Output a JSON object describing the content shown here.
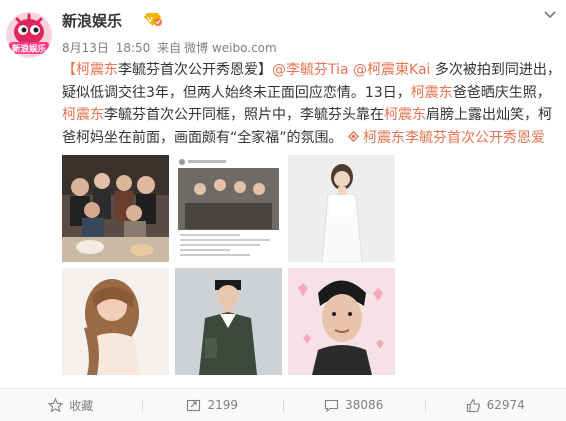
{
  "author": {
    "name": "新浪娱乐",
    "avatar_text": "新浪娱乐"
  },
  "meta": {
    "date": "8月13日",
    "time": "18:50",
    "source_prefix": "来自",
    "source": "微博 weibo.com"
  },
  "post": {
    "topic_open": "【",
    "topic_name": "柯震东",
    "topic_rest": "李毓芬首次公开秀恩爱】",
    "mention_1": "@李毓芬Tia",
    "mention_2": "@柯震東Kai",
    "text_1": " 多次被拍到同进出，疑似低调交往3年，但两人始终未正面回应恋情。13日，",
    "kw_1": "柯震东",
    "text_2": "爸爸晒庆生照，",
    "kw_2": "柯震东",
    "text_3": "李毓芬首次公开同框，照片中，李毓芬头靠在",
    "kw_3": "柯震东",
    "text_4": "肩膀上露出灿笑，柯爸柯妈坐在前面，画面颇有“全家福”的氛围。",
    "topic_link": "柯震东李毓芬首次公开秀恩爱"
  },
  "photos": [
    {
      "name": "photo-family-group"
    },
    {
      "name": "photo-instagram-post"
    },
    {
      "name": "photo-woman-white-dress"
    },
    {
      "name": "photo-woman-long-hair"
    },
    {
      "name": "photo-man-jacket"
    },
    {
      "name": "photo-man-selfie"
    }
  ],
  "actions": {
    "favorite_label": "收藏",
    "repost_count": "2199",
    "comment_count": "38086",
    "like_count": "62974"
  },
  "colors": {
    "accent": "#eb7350",
    "text": "#333333",
    "meta": "#808080",
    "action_bar": "#f9f9f9"
  },
  "icons": [
    "sina-ent-logo-icon",
    "verified-vip-icon",
    "chevron-down-icon",
    "star-icon",
    "repost-icon",
    "comment-icon",
    "thumbs-up-icon"
  ]
}
